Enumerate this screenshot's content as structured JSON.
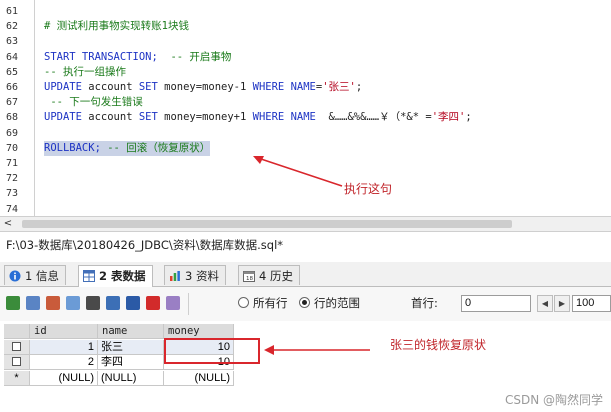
{
  "editor": {
    "line_numbers": [
      "61",
      "62",
      "63",
      "64",
      "65",
      "66",
      "67",
      "68",
      "69",
      "70",
      "71",
      "72",
      "73",
      "74"
    ],
    "lines": [
      {
        "n": "62",
        "parts": [
          {
            "t": "# 测试利用事物实现转账1块钱",
            "c": "cmt"
          }
        ]
      },
      {
        "n": "64",
        "parts": [
          {
            "t": "START TRANSACTION;",
            "c": "kw"
          },
          {
            "t": "  -- 开启事物",
            "c": "cmt"
          }
        ]
      },
      {
        "n": "65",
        "parts": [
          {
            "t": "-- 执行一组操作",
            "c": "cmt"
          }
        ]
      },
      {
        "n": "66",
        "parts": [
          {
            "t": "UPDATE",
            "c": "kw"
          },
          {
            "t": " account ",
            "c": "tx"
          },
          {
            "t": "SET",
            "c": "kw"
          },
          {
            "t": " money=money-1 ",
            "c": "tx"
          },
          {
            "t": "WHERE",
            "c": "kw"
          },
          {
            "t": " ",
            "c": "tx"
          },
          {
            "t": "NAME",
            "c": "kw"
          },
          {
            "t": "=",
            "c": "tx"
          },
          {
            "t": "'张三'",
            "c": "str"
          },
          {
            "t": ";",
            "c": "tx"
          }
        ]
      },
      {
        "n": "67",
        "parts": [
          {
            "t": " -- 下一句发生错误",
            "c": "cmt"
          }
        ]
      },
      {
        "n": "68",
        "parts": [
          {
            "t": "UPDATE",
            "c": "kw"
          },
          {
            "t": " account ",
            "c": "tx"
          },
          {
            "t": "SET",
            "c": "kw"
          },
          {
            "t": " money=money+1 ",
            "c": "tx"
          },
          {
            "t": "WHERE",
            "c": "kw"
          },
          {
            "t": " ",
            "c": "tx"
          },
          {
            "t": "NAME",
            "c": "kw"
          },
          {
            "t": "  &……&%&……￥（*&* =",
            "c": "tx"
          },
          {
            "t": "'李四'",
            "c": "str"
          },
          {
            "t": ";",
            "c": "tx"
          }
        ]
      },
      {
        "n": "70",
        "parts": [
          {
            "t": "ROLLBACK;",
            "c": "kw"
          },
          {
            "t": " -- 回滚（恢复原状）",
            "c": "cmt"
          }
        ]
      }
    ],
    "annotation": "执行这句",
    "hscroll_left": "<"
  },
  "path": "F:\\03-数据库\\20180426_JDBC\\资料\\数据库数据.sql*",
  "tabs": [
    {
      "label": "1 信息",
      "active": false,
      "icon": "info-icon"
    },
    {
      "label": "2 表数据",
      "active": true,
      "icon": "table-data-icon"
    },
    {
      "label": "3 资料",
      "active": false,
      "icon": "profile-icon"
    },
    {
      "label": "4 历史",
      "active": false,
      "icon": "history-icon"
    }
  ],
  "toolbar": {
    "radio_all": "所有行",
    "radio_range": "行的范围",
    "first_row_label": "首行:",
    "first_row_value": "0",
    "row_count_value": "100",
    "prev_label": "◀",
    "next_label": "▶"
  },
  "grid": {
    "columns": [
      "id",
      "name",
      "money"
    ],
    "rows": [
      {
        "marker": "",
        "id": "1",
        "name": "张三",
        "money": "10",
        "selected": true
      },
      {
        "marker": "",
        "id": "2",
        "name": "李四",
        "money": "10",
        "selected": false
      },
      {
        "marker": "*",
        "id": "(NULL)",
        "name": "(NULL)",
        "money": "(NULL)",
        "selected": false
      }
    ],
    "annotation": "张三的钱恢复原状"
  },
  "watermark": "CSDN @陶然同学",
  "colors": {
    "annotation": "#c0242a",
    "keyword": "#1d33c4",
    "comment": "#1a7a1a",
    "string": "#b3001b"
  }
}
